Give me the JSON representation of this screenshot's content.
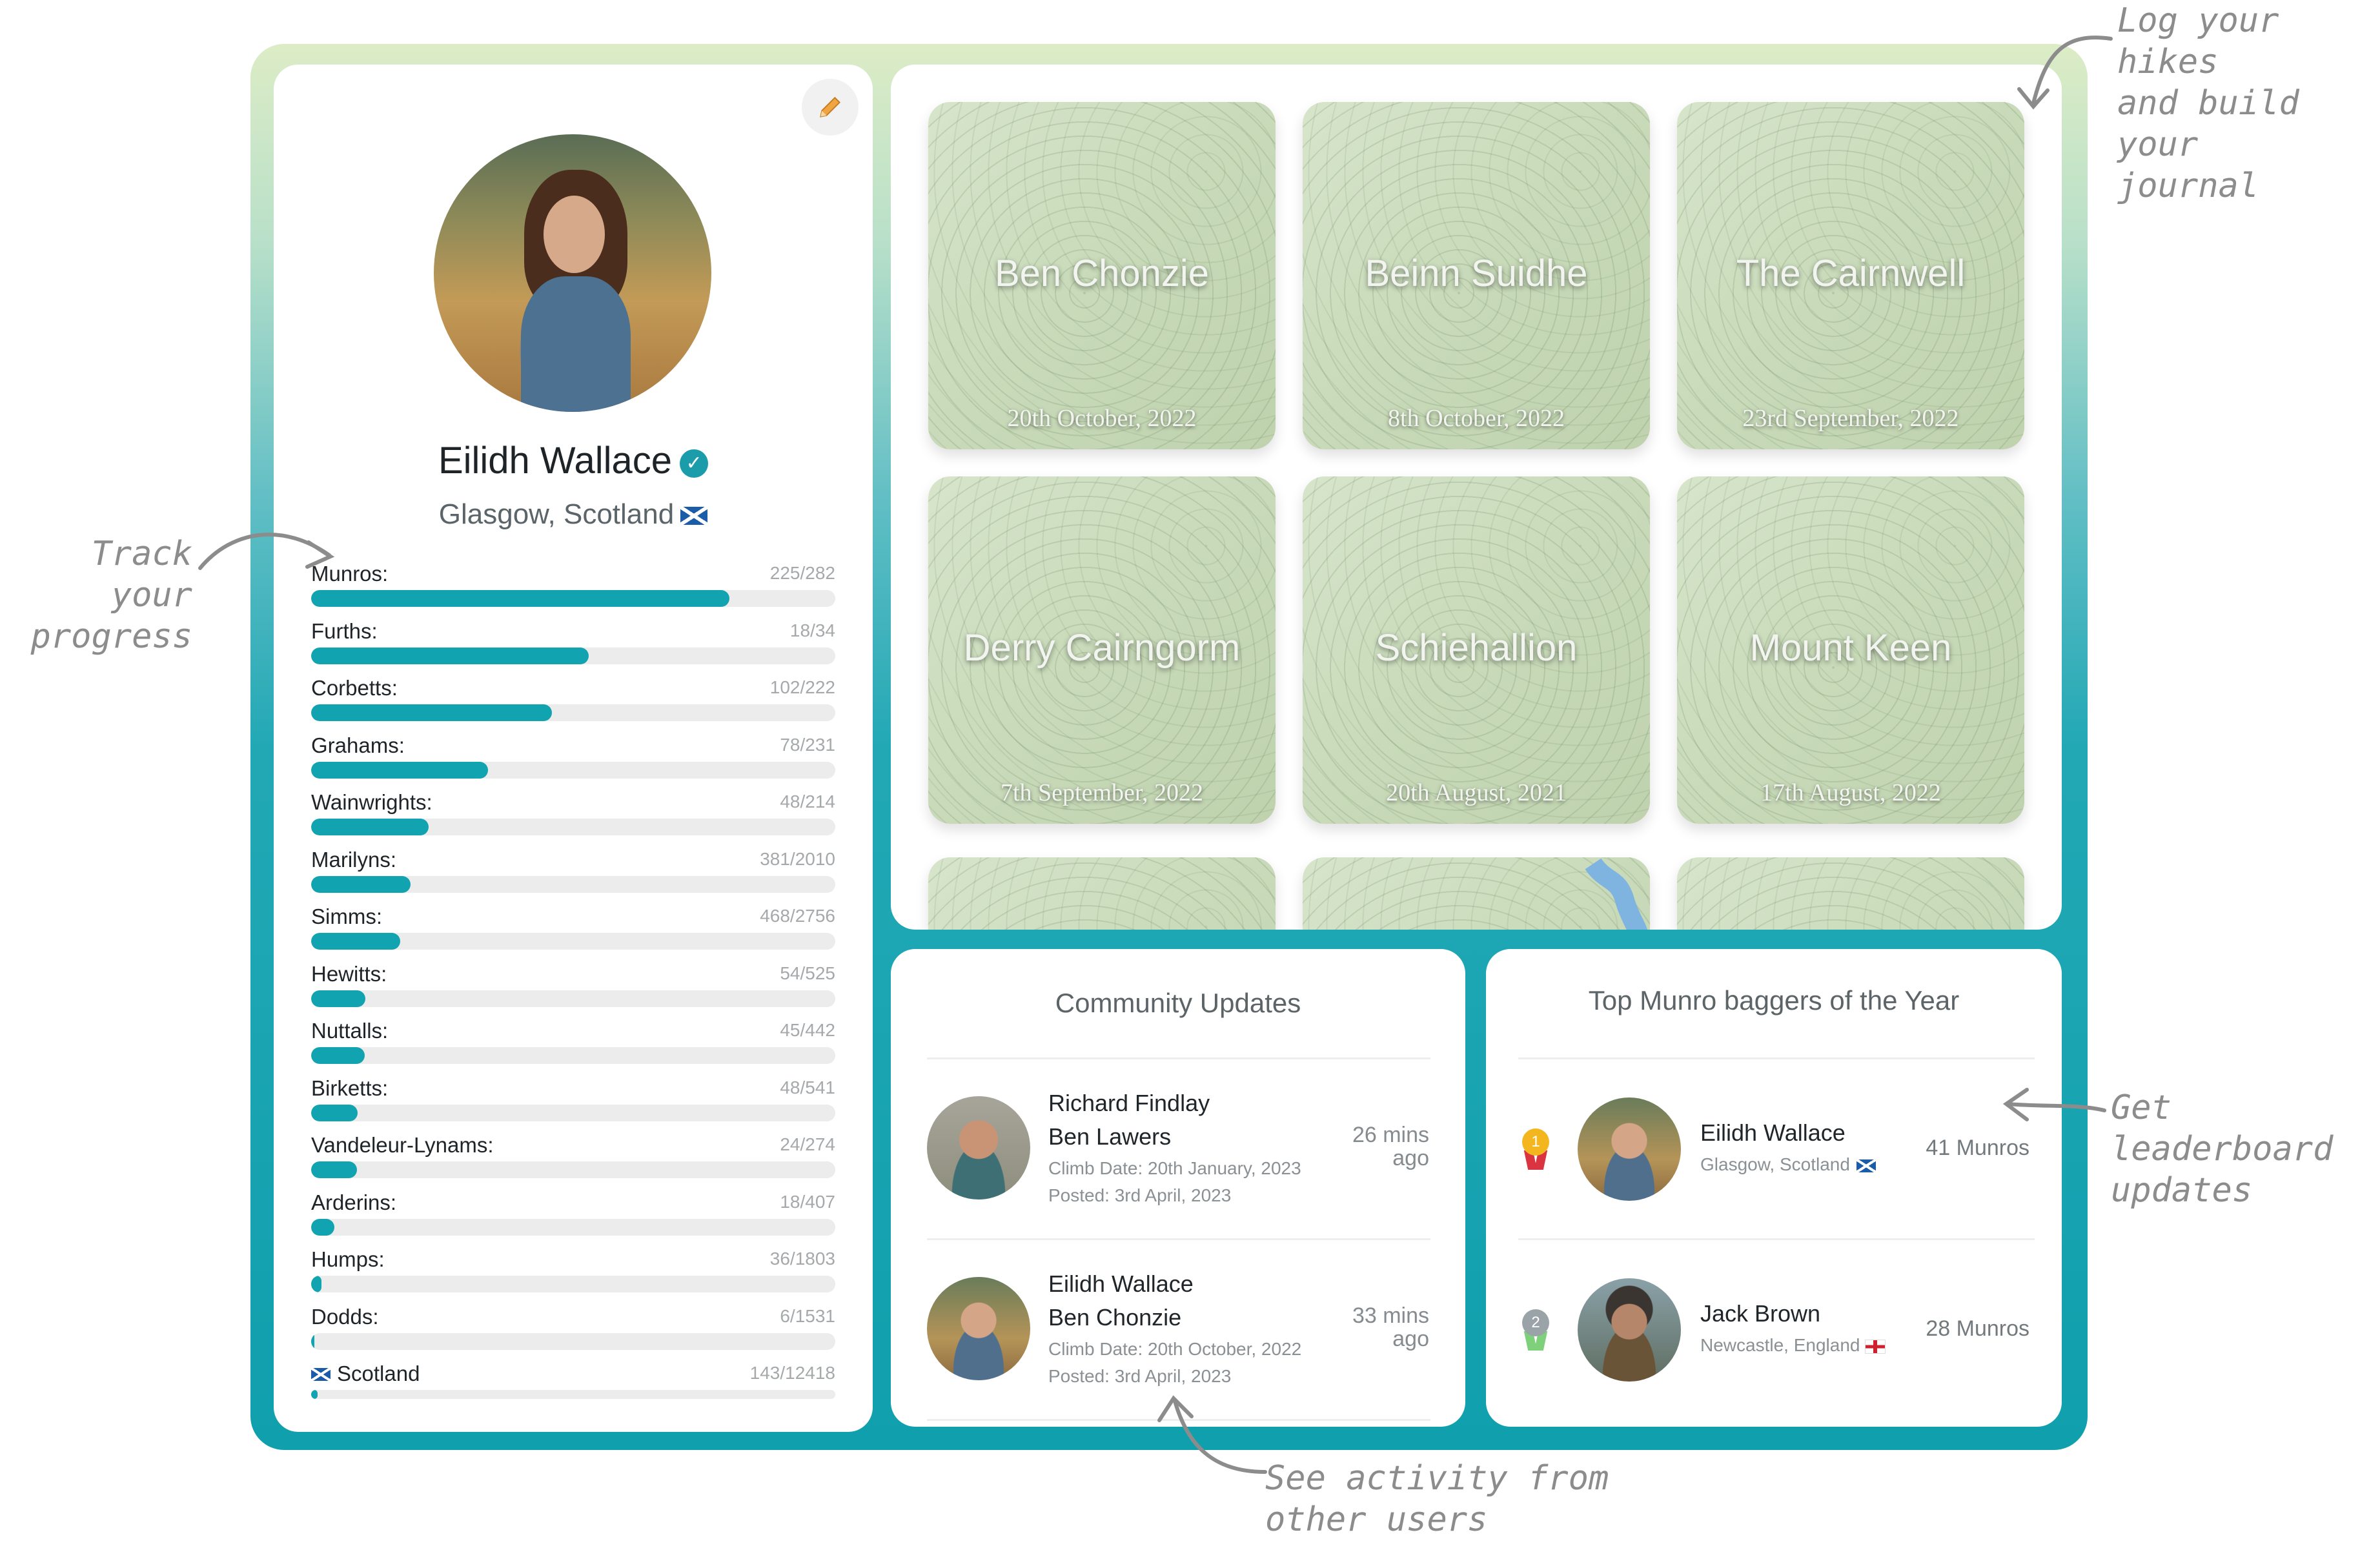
{
  "profile": {
    "name": "Eilidh Wallace",
    "location": "Glasgow, Scotland",
    "progress": [
      {
        "label": "Munros:",
        "count": "225/282",
        "fraction": 0.798
      },
      {
        "label": "Furths:",
        "count": "18/34",
        "fraction": 0.529
      },
      {
        "label": "Corbetts:",
        "count": "102/222",
        "fraction": 0.459
      },
      {
        "label": "Grahams:",
        "count": "78/231",
        "fraction": 0.338
      },
      {
        "label": "Wainwrights:",
        "count": "48/214",
        "fraction": 0.224
      },
      {
        "label": "Marilyns:",
        "count": "381/2010",
        "fraction": 0.19
      },
      {
        "label": "Simms:",
        "count": "468/2756",
        "fraction": 0.17
      },
      {
        "label": "Hewitts:",
        "count": "54/525",
        "fraction": 0.103
      },
      {
        "label": "Nuttalls:",
        "count": "45/442",
        "fraction": 0.102
      },
      {
        "label": "Birketts:",
        "count": "48/541",
        "fraction": 0.089
      },
      {
        "label": "Vandeleur-Lynams:",
        "count": "24/274",
        "fraction": 0.088
      },
      {
        "label": "Arderins:",
        "count": "18/407",
        "fraction": 0.044
      },
      {
        "label": "Humps:",
        "count": "36/1803",
        "fraction": 0.02
      },
      {
        "label": "Dodds:",
        "count": "6/1531",
        "fraction": 0.004
      },
      {
        "label": "Scotland",
        "count": "143/12418",
        "fraction": 0.012
      }
    ]
  },
  "hikes": [
    {
      "name": "Ben Chonzie",
      "date": "20th October, 2022"
    },
    {
      "name": "Beinn Suidhe",
      "date": "8th October, 2022"
    },
    {
      "name": "The Cairnwell",
      "date": "23rd September, 2022"
    },
    {
      "name": "Derry Cairngorm",
      "date": "7th September, 2022"
    },
    {
      "name": "Schiehallion",
      "date": "20th August, 2021"
    },
    {
      "name": "Mount Keen",
      "date": "17th August, 2022"
    }
  ],
  "community": {
    "title": "Community Updates",
    "items": [
      {
        "user": "Richard Findlay",
        "hill": "Ben Lawers",
        "climb": "Climb Date: 20th January, 2023",
        "posted": "Posted: 3rd April, 2023",
        "time1": "26 mins",
        "time2": "ago"
      },
      {
        "user": "Eilidh Wallace",
        "hill": "Ben Chonzie",
        "climb": "Climb Date: 20th October, 2022",
        "posted": "Posted: 3rd April, 2023",
        "time1": "33 mins",
        "time2": "ago"
      }
    ]
  },
  "leaderboard": {
    "title": "Top  Munro  baggers of the  Year",
    "items": [
      {
        "rank": "1",
        "name": "Eilidh Wallace",
        "location": "Glasgow, Scotland",
        "count": "41 Munros"
      },
      {
        "rank": "2",
        "name": "Jack Brown",
        "location": "Newcastle, England",
        "count": "28 Munros"
      }
    ]
  },
  "annotations": {
    "log1": "Log your hikes",
    "log2": "and build your",
    "log3": "journal",
    "track1": "Track your",
    "track2": "progress",
    "leader1": "Get leaderboard",
    "leader2": "updates",
    "activity1": "See activity from",
    "activity2": "other users"
  },
  "colors": {
    "accent": "#12a3b0",
    "track": "#ececec"
  }
}
